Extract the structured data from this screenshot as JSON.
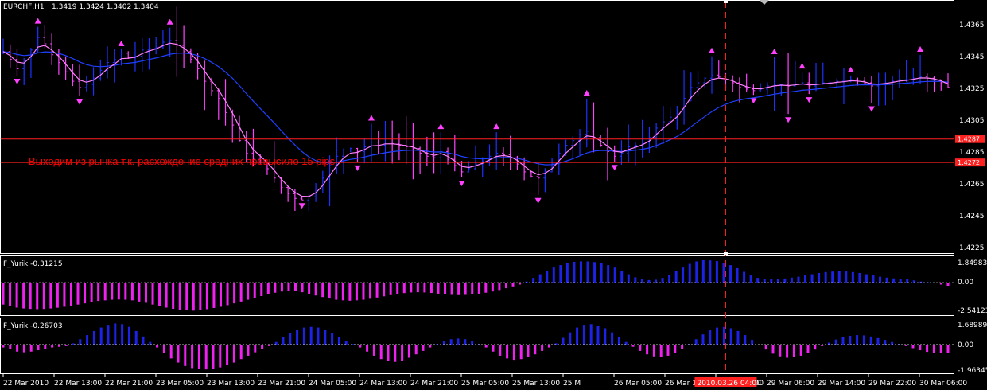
{
  "colors": {
    "background": "#000000",
    "frame": "#ffffff",
    "bar_bull": "#1e32ff",
    "bar_bear": "#ff44ff",
    "ma_fast": "#ff80ff",
    "ma_slow": "#2040ff",
    "arrow": "#ff40ff",
    "hline": "#ff2020",
    "hist_pos": "#1c22e6",
    "hist_neg": "#ee22ee",
    "zero_line": "#ffffff"
  },
  "main": {
    "title": "EURCHF,H1",
    "ohlc": "1.3419 1.3424 1.3402 1.3404",
    "annotation": "Выходим из рынка т.к. расхождение средних превысило 15 pips",
    "price_labels": [
      "1.4365",
      "1.4345",
      "1.4325",
      "1.4305",
      "1.4285",
      "1.4265",
      "1.4245",
      "1.4225"
    ],
    "marker_labels": [
      "1.4287",
      "1.4272"
    ]
  },
  "sub1": {
    "title": "F_Yurik -0.31215",
    "labels": [
      "1.84983",
      "0.00",
      "-2.54123"
    ]
  },
  "sub2": {
    "title": "F_Yurik -0.26703",
    "labels": [
      "1.68989",
      "0.00",
      "-1.96345"
    ]
  },
  "time_axis": {
    "labels": [
      "22 Mar 2010",
      "22 Mar 13:00",
      "22 Mar 21:00",
      "23 Mar 05:00",
      "23 Mar 13:00",
      "23 Mar 21:00",
      "24 Mar 05:00",
      "24 Mar 13:00",
      "24 Mar 21:00",
      "25 Mar 05:00",
      "25 Mar 13:00",
      "25 M",
      "26 Mar 05:00",
      "26 Mar 13:00",
      "26 Mar 21:00",
      "29 Mar 06:00",
      "29 Mar 14:00",
      "29 Mar 22:00",
      "30 Mar 06:00"
    ],
    "cursor_label": "2010.03.26 04:00"
  },
  "chart_data": [
    {
      "type": "candlestick",
      "title": "EURCHF,H1",
      "ylim": [
        1.4215,
        1.4375
      ],
      "series": [
        {
          "name": "EURCHF,H1",
          "close": [
            1.4343,
            1.4338,
            1.4332,
            1.4335,
            1.4344,
            1.4352,
            1.4348,
            1.4341,
            1.4336,
            1.433,
            1.4324,
            1.432,
            1.4322,
            1.4326,
            1.4331,
            1.4336,
            1.4338,
            1.4342,
            1.4339,
            1.434,
            1.4344,
            1.4345,
            1.4346,
            1.4349,
            1.435,
            1.4347,
            1.4343,
            1.4338,
            1.4332,
            1.4324,
            1.4318,
            1.4313,
            1.4304,
            1.4296,
            1.4286,
            1.4278,
            1.4274,
            1.4272,
            1.4268,
            1.4262,
            1.4256,
            1.4252,
            1.4249,
            1.4248,
            1.425,
            1.4255,
            1.4262,
            1.427,
            1.4276,
            1.428,
            1.4281,
            1.4279,
            1.4282,
            1.4285,
            1.4283,
            1.4285,
            1.4284,
            1.4283,
            1.4282,
            1.4281,
            1.4278,
            1.4276,
            1.4275,
            1.4279,
            1.4274,
            1.427,
            1.4266,
            1.4268,
            1.4271,
            1.4273,
            1.4276,
            1.4278,
            1.4277,
            1.4275,
            1.4271,
            1.4266,
            1.4263,
            1.4262,
            1.4266,
            1.4271,
            1.4278,
            1.4283,
            1.4286,
            1.429,
            1.4292,
            1.4288,
            1.4283,
            1.4279,
            1.4276,
            1.4278,
            1.4282,
            1.4283,
            1.4285,
            1.4288,
            1.4294,
            1.4298,
            1.4301,
            1.4305,
            1.4313,
            1.432,
            1.4323,
            1.4326,
            1.4328,
            1.4327,
            1.4325,
            1.4323,
            1.432,
            1.4319,
            1.4318,
            1.4319,
            1.4321,
            1.4322,
            1.4322,
            1.4321,
            1.4322,
            1.4323,
            1.4321,
            1.4322,
            1.4323,
            1.4323,
            1.4324,
            1.4324,
            1.4325,
            1.4324,
            1.4323,
            1.4321,
            1.4322,
            1.4323,
            1.4324,
            1.4325,
            1.4325,
            1.4326,
            1.4327,
            1.4326,
            1.4325,
            1.4323,
            1.432
          ]
        },
        {
          "name": "MA fast",
          "values": []
        },
        {
          "name": "MA slow",
          "values": []
        }
      ],
      "hlines": [
        1.4287,
        1.4272
      ],
      "cursor_index": 104
    },
    {
      "type": "bar",
      "title": "F_Yurik -0.31215",
      "ylim": [
        -2.54123,
        1.84983
      ],
      "series": [
        {
          "name": "F_Yurik",
          "values": [
            -1.8,
            -1.95,
            -2.05,
            -2.12,
            -2.16,
            -2.18,
            -2.16,
            -2.12,
            -2.06,
            -1.98,
            -1.9,
            -1.8,
            -1.7,
            -1.6,
            -1.5,
            -1.45,
            -1.4,
            -1.38,
            -1.4,
            -1.45,
            -1.55,
            -1.65,
            -1.8,
            -1.95,
            -2.05,
            -2.15,
            -2.22,
            -2.28,
            -2.3,
            -2.25,
            -2.18,
            -2.08,
            -1.98,
            -1.85,
            -1.7,
            -1.55,
            -1.4,
            -1.25,
            -1.1,
            -0.95,
            -0.82,
            -0.72,
            -0.68,
            -0.7,
            -0.78,
            -0.9,
            -1.05,
            -1.18,
            -1.3,
            -1.4,
            -1.45,
            -1.48,
            -1.45,
            -1.4,
            -1.32,
            -1.22,
            -1.12,
            -1.02,
            -0.92,
            -0.85,
            -0.8,
            -0.78,
            -0.8,
            -0.84,
            -0.9,
            -0.96,
            -1.0,
            -1.02,
            -1.0,
            -0.96,
            -0.9,
            -0.82,
            -0.72,
            -0.6,
            -0.45,
            -0.3,
            -0.15,
            0.1,
            0.4,
            0.7,
            1.0,
            1.25,
            1.45,
            1.62,
            1.72,
            1.76,
            1.75,
            1.7,
            1.6,
            1.45,
            1.25,
            1.0,
            0.7,
            0.45,
            0.3,
            0.22,
            0.25,
            0.4,
            0.65,
            0.95,
            1.25,
            1.55,
            1.75,
            1.85,
            1.84,
            1.78,
            1.65,
            1.45,
            1.2,
            0.9,
            0.6,
            0.4,
            0.3,
            0.28,
            0.3,
            0.35,
            0.42,
            0.5,
            0.6,
            0.7,
            0.8,
            0.88,
            0.92,
            0.95,
            0.93,
            0.88,
            0.8,
            0.7,
            0.6,
            0.5,
            0.42,
            0.36,
            0.32,
            0.3,
            0.2,
            0.1,
            0.05,
            -0.05,
            -0.15,
            -0.25
          ]
        }
      ]
    },
    {
      "type": "bar",
      "title": "F_Yurik -0.26703",
      "ylim": [
        -1.96345,
        1.68989
      ],
      "series": [
        {
          "name": "F_Yurik",
          "values": [
            -0.2,
            -0.3,
            -0.5,
            -0.55,
            -0.5,
            -0.4,
            -0.3,
            -0.2,
            -0.15,
            -0.1,
            0.1,
            0.4,
            0.7,
            1.0,
            1.25,
            1.45,
            1.55,
            1.5,
            1.3,
            1.0,
            0.6,
            0.2,
            -0.2,
            -0.6,
            -1.0,
            -1.3,
            -1.55,
            -1.7,
            -1.78,
            -1.8,
            -1.75,
            -1.65,
            -1.5,
            -1.3,
            -1.05,
            -0.8,
            -0.55,
            -0.3,
            -0.1,
            0.2,
            0.55,
            0.85,
            1.1,
            1.25,
            1.3,
            1.25,
            1.1,
            0.85,
            0.55,
            0.25,
            0.05,
            -0.2,
            -0.5,
            -0.8,
            -1.05,
            -1.2,
            -1.25,
            -1.15,
            -0.95,
            -0.7,
            -0.45,
            -0.2,
            0.05,
            0.25,
            0.4,
            0.45,
            0.4,
            0.25,
            0.05,
            -0.2,
            -0.5,
            -0.8,
            -1.0,
            -1.1,
            -1.05,
            -0.9,
            -0.7,
            -0.45,
            -0.2,
            0.1,
            0.5,
            0.9,
            1.25,
            1.45,
            1.5,
            1.4,
            1.2,
            0.9,
            0.55,
            0.2,
            -0.15,
            -0.45,
            -0.7,
            -0.85,
            -0.9,
            -0.8,
            -0.6,
            -0.3,
            0.05,
            0.4,
            0.75,
            1.05,
            1.25,
            1.3,
            1.2,
            1.0,
            0.7,
            0.35,
            0.0,
            -0.35,
            -0.65,
            -0.85,
            -0.95,
            -0.92,
            -0.8,
            -0.6,
            -0.35,
            -0.1,
            0.15,
            0.38,
            0.55,
            0.65,
            0.7,
            0.68,
            0.6,
            0.48,
            0.35,
            0.2,
            0.05,
            -0.1,
            -0.25,
            -0.4,
            -0.52,
            -0.6,
            -0.62,
            -0.58
          ]
        }
      ]
    }
  ]
}
